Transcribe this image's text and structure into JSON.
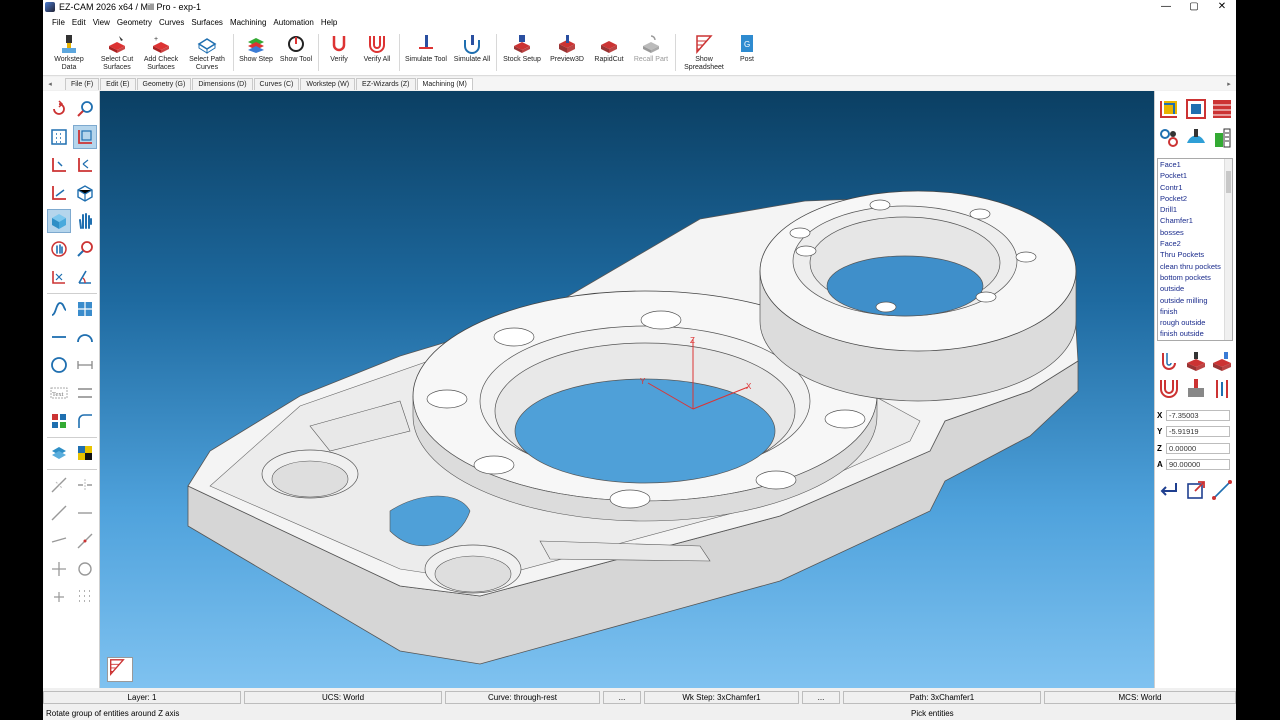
{
  "window": {
    "title": "EZ-CAM 2026 x64 / Mill Pro  - exp-1",
    "minimize": "—",
    "restore": "▢",
    "close": "✕"
  },
  "menu": [
    "File",
    "Edit",
    "View",
    "Geometry",
    "Curves",
    "Surfaces",
    "Machining",
    "Automation",
    "Help"
  ],
  "ribbon": [
    {
      "label": "Workstep\nData",
      "icon": "workstep-data-icon"
    },
    {
      "label": "Select Cut\nSurfaces",
      "icon": "select-cut-surfaces-icon"
    },
    {
      "label": "Add Check\nSurfaces",
      "icon": "add-check-surfaces-icon"
    },
    {
      "label": "Select Path\nCurves",
      "icon": "select-path-curves-icon"
    },
    {
      "label": "Show Step",
      "icon": "show-step-icon"
    },
    {
      "label": "Show Tool",
      "icon": "show-tool-icon"
    },
    {
      "label": "Verify",
      "icon": "verify-icon"
    },
    {
      "label": "Verify All",
      "icon": "verify-all-icon"
    },
    {
      "label": "Simulate Tool",
      "icon": "simulate-tool-icon"
    },
    {
      "label": "Simulate All",
      "icon": "simulate-all-icon"
    },
    {
      "label": "Stock Setup",
      "icon": "stock-setup-icon"
    },
    {
      "label": "Preview3D",
      "icon": "preview3d-icon"
    },
    {
      "label": "RapidCut",
      "icon": "rapidcut-icon"
    },
    {
      "label": "Recall Part",
      "icon": "recall-part-icon",
      "disabled": true
    },
    {
      "label": "Show\nSpreadsheet",
      "icon": "spreadsheet-icon"
    },
    {
      "label": "Post",
      "icon": "post-icon"
    }
  ],
  "tabs": [
    "File (F)",
    "Edit (E)",
    "Geometry (G)",
    "Dimensions (D)",
    "Curves (C)",
    "Workstep (W)",
    "EZ-Wizards (Z)",
    "Machining (M)"
  ],
  "active_tab": "Machining (M)",
  "operations": [
    "Face1",
    "Pocket1",
    "Contr1",
    "Pocket2",
    "Drill1",
    "Chamfer1",
    "bosses",
    "Face2",
    "Thru Pockets",
    "clean thru pockets",
    "bottom pockets",
    "outside",
    "outside milling",
    "finish",
    "rough outside",
    "finish outside"
  ],
  "coords": {
    "x_label": "X",
    "x": "-7.35003",
    "y_label": "Y",
    "y": "-5.91919",
    "z_label": "Z",
    "z": "0.00000",
    "a_label": "A",
    "a": "90.00000"
  },
  "axis_labels": {
    "x": "X",
    "y": "Y",
    "z": "Z"
  },
  "status": {
    "layer": "Layer: 1",
    "ucs": "UCS: World",
    "curve": "Curve: through-rest",
    "curve_more": "...",
    "wk_step": "Wk Step: 3xChamfer1",
    "wk_more": "...",
    "path": "Path: 3xChamfer1",
    "mcs": "MCS: World"
  },
  "hint": "Rotate group of entities around Z axis",
  "pick": "Pick entities",
  "colors": {
    "viewport_top": "#0b3f63",
    "viewport_bottom": "#7fc2f0",
    "part": "#f4f4f4",
    "list_text": "#1a2b8c"
  }
}
